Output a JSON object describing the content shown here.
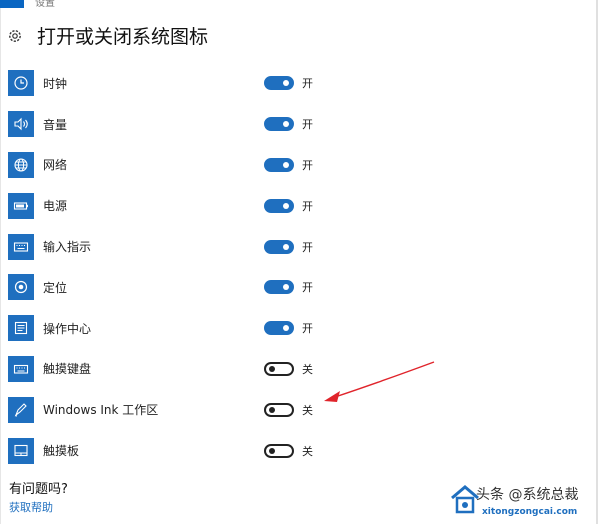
{
  "window": {
    "caption": "设置"
  },
  "page": {
    "title": "打开或关闭系统图标"
  },
  "items": [
    {
      "label": "时钟",
      "state": "开",
      "on": true,
      "icon": "clock-icon"
    },
    {
      "label": "音量",
      "state": "开",
      "on": true,
      "icon": "volume-icon"
    },
    {
      "label": "网络",
      "state": "开",
      "on": true,
      "icon": "network-globe-icon"
    },
    {
      "label": "电源",
      "state": "开",
      "on": true,
      "icon": "battery-icon"
    },
    {
      "label": "输入指示",
      "state": "开",
      "on": true,
      "icon": "keyboard-icon"
    },
    {
      "label": "定位",
      "state": "开",
      "on": true,
      "icon": "location-icon"
    },
    {
      "label": "操作中心",
      "state": "开",
      "on": true,
      "icon": "action-center-icon"
    },
    {
      "label": "触摸键盘",
      "state": "关",
      "on": false,
      "icon": "touch-keyboard-icon"
    },
    {
      "label": "Windows Ink 工作区",
      "state": "关",
      "on": false,
      "icon": "windows-ink-pen-icon"
    },
    {
      "label": "触摸板",
      "state": "关",
      "on": false,
      "icon": "touchpad-icon"
    }
  ],
  "help": {
    "question": "有问题吗?",
    "link": "获取帮助"
  },
  "watermark": {
    "line1": "头条 @系统总裁",
    "brand": "系统总裁",
    "url": "xitongzongcai.com"
  },
  "colors": {
    "accent": "#1f6fbf",
    "annotation_arrow": "#e0242b"
  }
}
